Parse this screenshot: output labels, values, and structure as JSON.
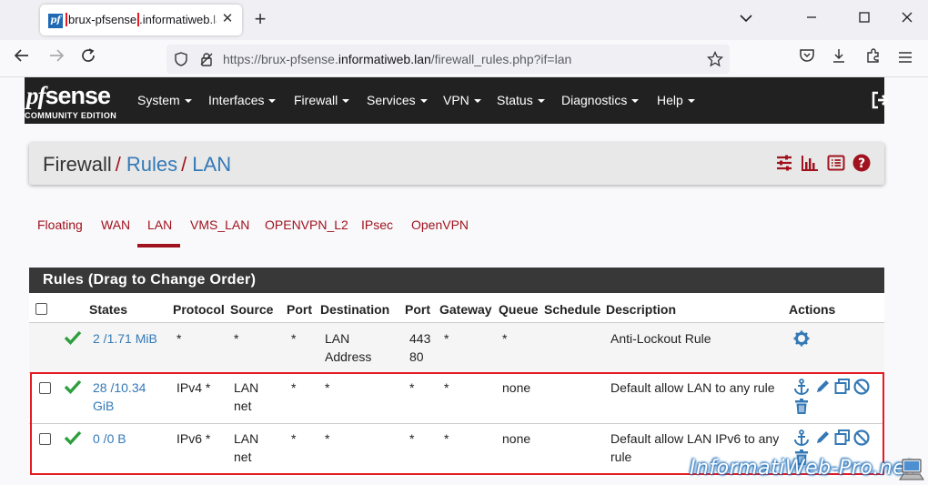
{
  "browser": {
    "tab_title_highlight": "brux-pfsense",
    "tab_title_rest": ".informatiweb.lan",
    "favicon_text": "pf",
    "url_prefix": "https://brux-pfsense.",
    "url_domain": "informatiweb.lan",
    "url_path": "/firewall_rules.php?if=lan"
  },
  "header": {
    "logo_text": "sense",
    "logo_pf": "pf",
    "logo_sub": "COMMUNITY EDITION",
    "menu": [
      "System",
      "Interfaces",
      "Firewall",
      "Services",
      "VPN",
      "Status",
      "Diagnostics",
      "Help"
    ]
  },
  "breadcrumb": [
    "Firewall",
    "Rules",
    "LAN"
  ],
  "subtabs": [
    "Floating",
    "WAN",
    "LAN",
    "VMS_LAN",
    "OPENVPN_L2",
    "IPsec",
    "OpenVPN"
  ],
  "active_subtab": "LAN",
  "rules": {
    "title": "Rules (Drag to Change Order)",
    "columns": [
      "States",
      "Protocol",
      "Source",
      "Port",
      "Destination",
      "Port",
      "Gateway",
      "Queue",
      "Schedule",
      "Description",
      "Actions"
    ],
    "rows": [
      {
        "states": "2 /1.71 MiB",
        "protocol": "*",
        "source": "*",
        "sport": "*",
        "dest": "LAN Address",
        "dport": "443 80",
        "gateway": "*",
        "queue": "*",
        "schedule": "",
        "description": "Anti-Lockout Rule"
      },
      {
        "states": "28 /10.34 GiB",
        "protocol": "IPv4 *",
        "source": "LAN net",
        "sport": "*",
        "dest": "*",
        "dport": "*",
        "gateway": "*",
        "queue": "none",
        "schedule": "",
        "description": "Default allow LAN to any rule"
      },
      {
        "states": "0 /0 B",
        "protocol": "IPv6 *",
        "source": "LAN net",
        "sport": "*",
        "dest": "*",
        "dport": "*",
        "gateway": "*",
        "queue": "none",
        "schedule": "",
        "description": "Default allow LAN IPv6 to any rule"
      }
    ]
  },
  "watermark": "InformatiWeb-Pro.net",
  "colors": {
    "accent_red": "#a0131e",
    "link_blue": "#3479b6",
    "header_bg": "#212121",
    "check_green": "#2e9e3e",
    "highlight_red": "#e31b23"
  }
}
